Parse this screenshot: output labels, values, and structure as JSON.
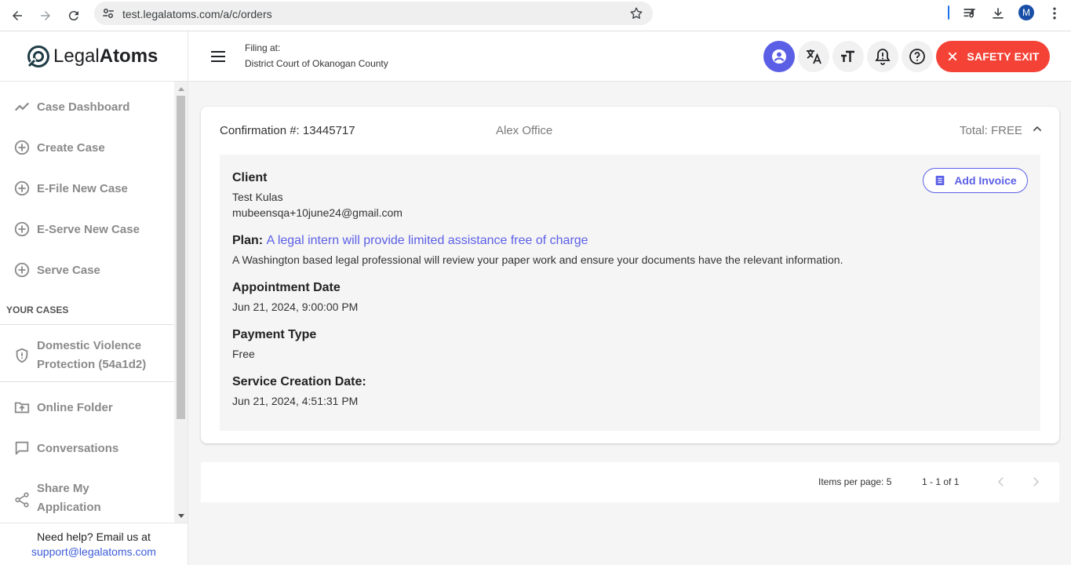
{
  "browser": {
    "url": "test.legalatoms.com/a/c/orders",
    "profile_initial": "M"
  },
  "header": {
    "brand_light": "Legal",
    "brand_bold": "Atoms",
    "filing_label": "Filing at:",
    "filing_court": "District Court of Okanogan County",
    "safety_exit": "SAFETY EXIT"
  },
  "sidebar": {
    "items": [
      {
        "label": "Case Dashboard",
        "icon": "trend-icon"
      },
      {
        "label": "Create Case",
        "icon": "add-circle-icon"
      },
      {
        "label": "E-File New Case",
        "icon": "add-circle-icon"
      },
      {
        "label": "E-Serve New Case",
        "icon": "add-circle-icon"
      },
      {
        "label": "Serve Case",
        "icon": "add-circle-icon"
      }
    ],
    "your_cases_heading": "YOUR CASES",
    "case_line1": "Domestic Violence",
    "case_line2": "Protection (54a1d2)",
    "online_folder": "Online Folder",
    "conversations": "Conversations",
    "share_line1": "Share My",
    "share_line2": "Application"
  },
  "help": {
    "text": "Need help? Email us at",
    "email": "support@legalatoms.com"
  },
  "order": {
    "confirmation": "Confirmation #: 13445717",
    "office": "Alex Office",
    "total": "Total: FREE",
    "client_heading": "Client",
    "client_name": "Test Kulas",
    "client_email": "mubeensqa+10june24@gmail.com",
    "add_invoice": "Add Invoice",
    "plan_heading": "Plan:",
    "plan_link": "A legal intern will provide limited assistance free of charge",
    "plan_description": "A Washington based legal professional will review your paper work and ensure your documents have the relevant information.",
    "appointment_heading": "Appointment Date",
    "appointment_value": "Jun 21, 2024, 9:00:00 PM",
    "payment_heading": "Payment Type",
    "payment_value": "Free",
    "service_heading": "Service Creation Date:",
    "service_value": "Jun 21, 2024, 4:51:31 PM"
  },
  "paginator": {
    "items_per_page": "Items per page: 5",
    "range": "1 - 1 of 1"
  },
  "colors": {
    "accent": "#5b5fe6",
    "danger": "#f44336",
    "link": "#3a5bd9"
  }
}
